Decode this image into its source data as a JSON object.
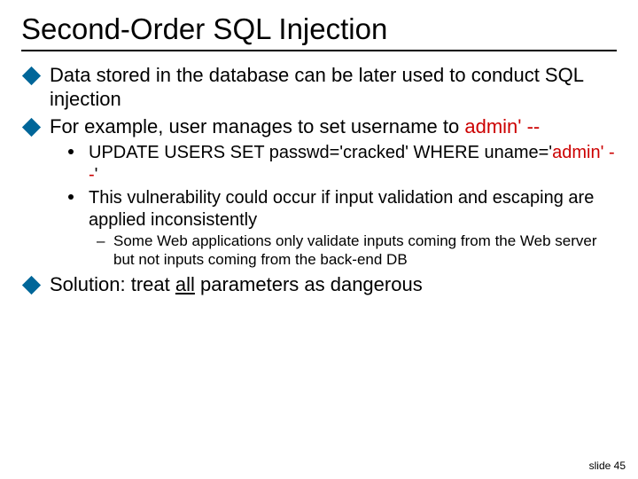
{
  "title": "Second-Order SQL Injection",
  "bullets": {
    "b1": "Data stored in the database can be later used to conduct SQL injection",
    "b2_a": "For example, user manages to set username to ",
    "b2_b": "admin' --",
    "s1_a": "UPDATE USERS SET passwd='cracked' WHERE uname='",
    "s1_b": "admin' --",
    "s1_c": "'",
    "s2": "This vulnerability could occur if input validation and escaping are applied inconsistently",
    "t1": "Some Web applications only validate inputs coming from the Web server but not inputs coming from the back-end DB",
    "b3_a": "Solution: treat ",
    "b3_b": "all",
    "b3_c": " parameters as dangerous"
  },
  "footer": "slide 45"
}
